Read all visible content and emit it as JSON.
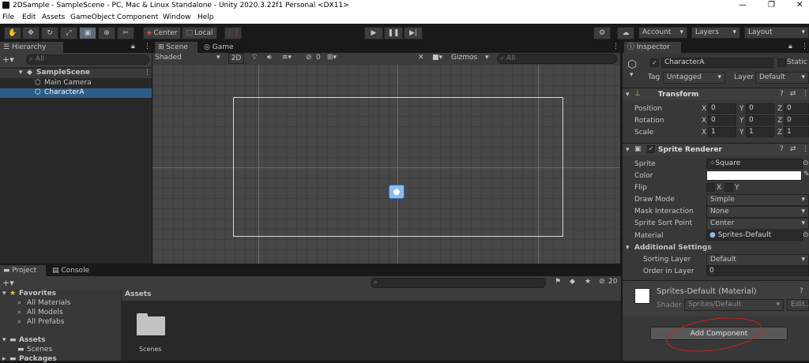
{
  "window": {
    "title": "2DSample - SampleScene - PC, Mac & Linux Standalone - Unity 2020.3.22f1 Personal <DX11>",
    "controls": [
      "—",
      "❐",
      "✕"
    ]
  },
  "menu": [
    "File",
    "Edit",
    "Assets",
    "GameObject",
    "Component",
    "Window",
    "Help"
  ],
  "toolbar": {
    "pivot": "Center",
    "space": "Local",
    "account": "Account",
    "layers": "Layers",
    "layout": "Layout"
  },
  "hierarchy": {
    "tab": "Hierarchy",
    "search_placeholder": "All",
    "scene": "SampleScene",
    "items": [
      "Main Camera",
      "CharacterA"
    ]
  },
  "scene_view": {
    "tab_scene": "Scene",
    "tab_game": "Game",
    "shading": "Shaded",
    "mode2d": "2D",
    "hidden_count": "0",
    "gizmos": "Gizmos",
    "search_placeholder": "All"
  },
  "inspector": {
    "tab": "Inspector",
    "object_name": "CharacterA",
    "static_label": "Static",
    "tag_label": "Tag",
    "tag_value": "Untagged",
    "layer_label": "Layer",
    "layer_value": "Default",
    "transform": {
      "title": "Transform",
      "rows": [
        {
          "label": "Position",
          "x": "0",
          "y": "0",
          "z": "0"
        },
        {
          "label": "Rotation",
          "x": "0",
          "y": "0",
          "z": "0"
        },
        {
          "label": "Scale",
          "x": "1",
          "y": "1",
          "z": "1"
        }
      ]
    },
    "sprite_renderer": {
      "title": "Sprite Renderer",
      "sprite_label": "Sprite",
      "sprite_value": "Square",
      "color_label": "Color",
      "color_value": "#ffffff",
      "flip_label": "Flip",
      "flip_x": "X",
      "flip_y": "Y",
      "draw_mode_label": "Draw Mode",
      "draw_mode_value": "Simple",
      "mask_label": "Mask Interaction",
      "mask_value": "None",
      "sort_point_label": "Sprite Sort Point",
      "sort_point_value": "Center",
      "material_label": "Material",
      "material_value": "Sprites-Default",
      "additional": "Additional Settings",
      "sorting_layer_label": "Sorting Layer",
      "sorting_layer_value": "Default",
      "order_label": "Order in Layer",
      "order_value": "0"
    },
    "material": {
      "name": "Sprites-Default (Material)",
      "shader_label": "Shader",
      "shader_value": "Sprites/Default",
      "edit": "Edit..."
    },
    "add_component": "Add Component"
  },
  "project": {
    "tab_project": "Project",
    "tab_console": "Console",
    "hidden_count": "20",
    "tree": {
      "favorites": "Favorites",
      "fav_items": [
        "All Materials",
        "All Models",
        "All Prefabs"
      ],
      "assets": "Assets",
      "asset_items": [
        "Scenes"
      ],
      "packages": "Packages"
    },
    "breadcrumb": "Assets",
    "folder_label": "Scenes"
  }
}
